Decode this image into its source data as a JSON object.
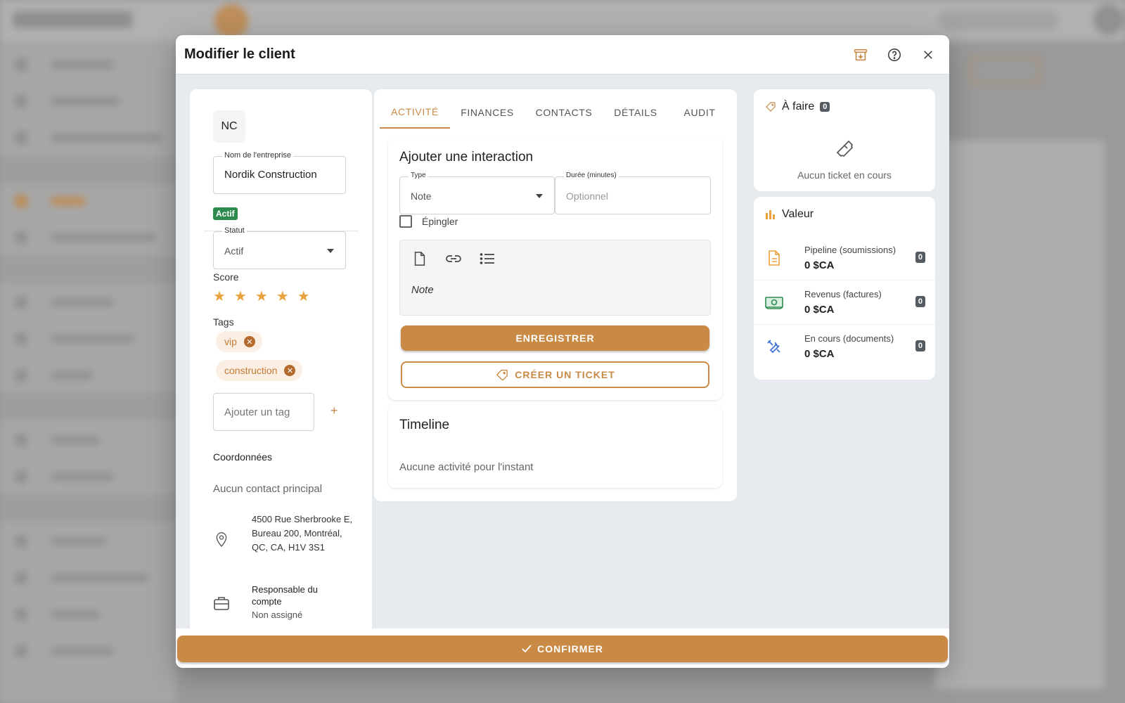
{
  "modal": {
    "title": "Modifier le client",
    "confirm_label": "CONFIRMER"
  },
  "client": {
    "initials": "NC",
    "company_label": "Nom de l'entreprise",
    "company_value": "Nordik Construction",
    "status_badge": "Actif",
    "status_label": "Statut",
    "status_value": "Actif",
    "score_label": "Score",
    "score_value": 5,
    "tags_label": "Tags",
    "tags": [
      "vip",
      "construction"
    ],
    "add_tag_placeholder": "Ajouter un tag",
    "add_tag_plus": "+",
    "coordinates_title": "Coordonnées",
    "no_contact": "Aucun contact principal",
    "address": "4500 Rue Sherbrooke E, Bureau 200, Montréal, QC, CA, H1V 3S1",
    "account_manager_label": "Responsable du compte",
    "account_manager_value": "Non assigné"
  },
  "tabs": [
    {
      "label": "ACTIVITÉ",
      "active": true
    },
    {
      "label": "FINANCES",
      "active": false
    },
    {
      "label": "CONTACTS",
      "active": false
    },
    {
      "label": "DÉTAILS",
      "active": false
    },
    {
      "label": "AUDIT",
      "active": false
    }
  ],
  "interaction": {
    "title": "Ajouter une interaction",
    "type_label": "Type",
    "type_value": "Note",
    "duration_label": "Durée (minutes)",
    "duration_placeholder": "Optionnel",
    "pin_label": "Épingler",
    "editor_text": "Note",
    "save_label": "ENREGISTRER",
    "ticket_label": "CRÉER UN TICKET"
  },
  "timeline": {
    "title": "Timeline",
    "empty": "Aucune activité pour l'instant"
  },
  "todo": {
    "title": "À faire",
    "count": "0",
    "empty": "Aucun ticket en cours"
  },
  "value": {
    "title": "Valeur",
    "rows": [
      {
        "label": "Pipeline (soumissions)",
        "amount": "0 $CA",
        "count": "0",
        "icon": "document-icon"
      },
      {
        "label": "Revenus (factures)",
        "amount": "0 $CA",
        "count": "0",
        "icon": "cash-icon"
      },
      {
        "label": "En cours (documents)",
        "amount": "0 $CA",
        "count": "0",
        "icon": "tools-icon"
      }
    ]
  },
  "colors": {
    "accent": "#c98a45",
    "success": "#2e8b4e",
    "badge": "#555b63"
  }
}
